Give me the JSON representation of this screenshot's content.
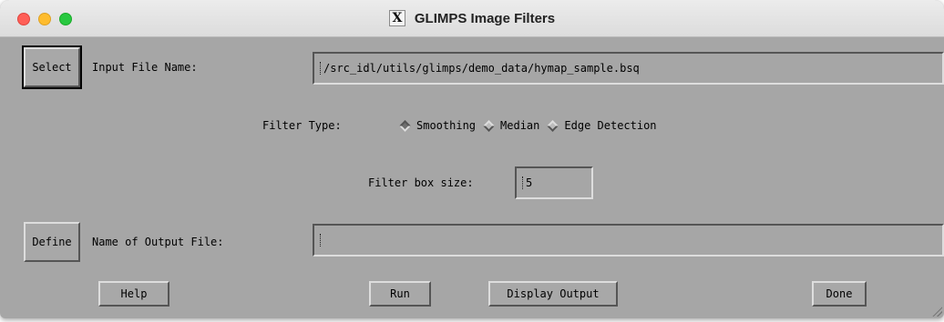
{
  "window": {
    "title": "GLIMPS Image Filters",
    "x_icon": "X"
  },
  "input": {
    "select_button": "Select",
    "label": "Input File Name:",
    "value": "/src_idl/utils/glimps/demo_data/hymap_sample.bsq"
  },
  "filter_type": {
    "label": "Filter Type:",
    "options": [
      "Smoothing",
      "Median",
      "Edge Detection"
    ],
    "selected": "Smoothing"
  },
  "box_size": {
    "label": "Filter box size:",
    "value": "5"
  },
  "output": {
    "define_button": "Define",
    "label": "Name of Output File:",
    "value": ""
  },
  "actions": {
    "help": "Help",
    "run": "Run",
    "display_output": "Display Output",
    "done": "Done"
  },
  "icons": {
    "close": "close-icon",
    "minimize": "minimize-icon",
    "zoom": "zoom-icon",
    "app": "x11-icon",
    "resize": "resize-grip-icon"
  }
}
